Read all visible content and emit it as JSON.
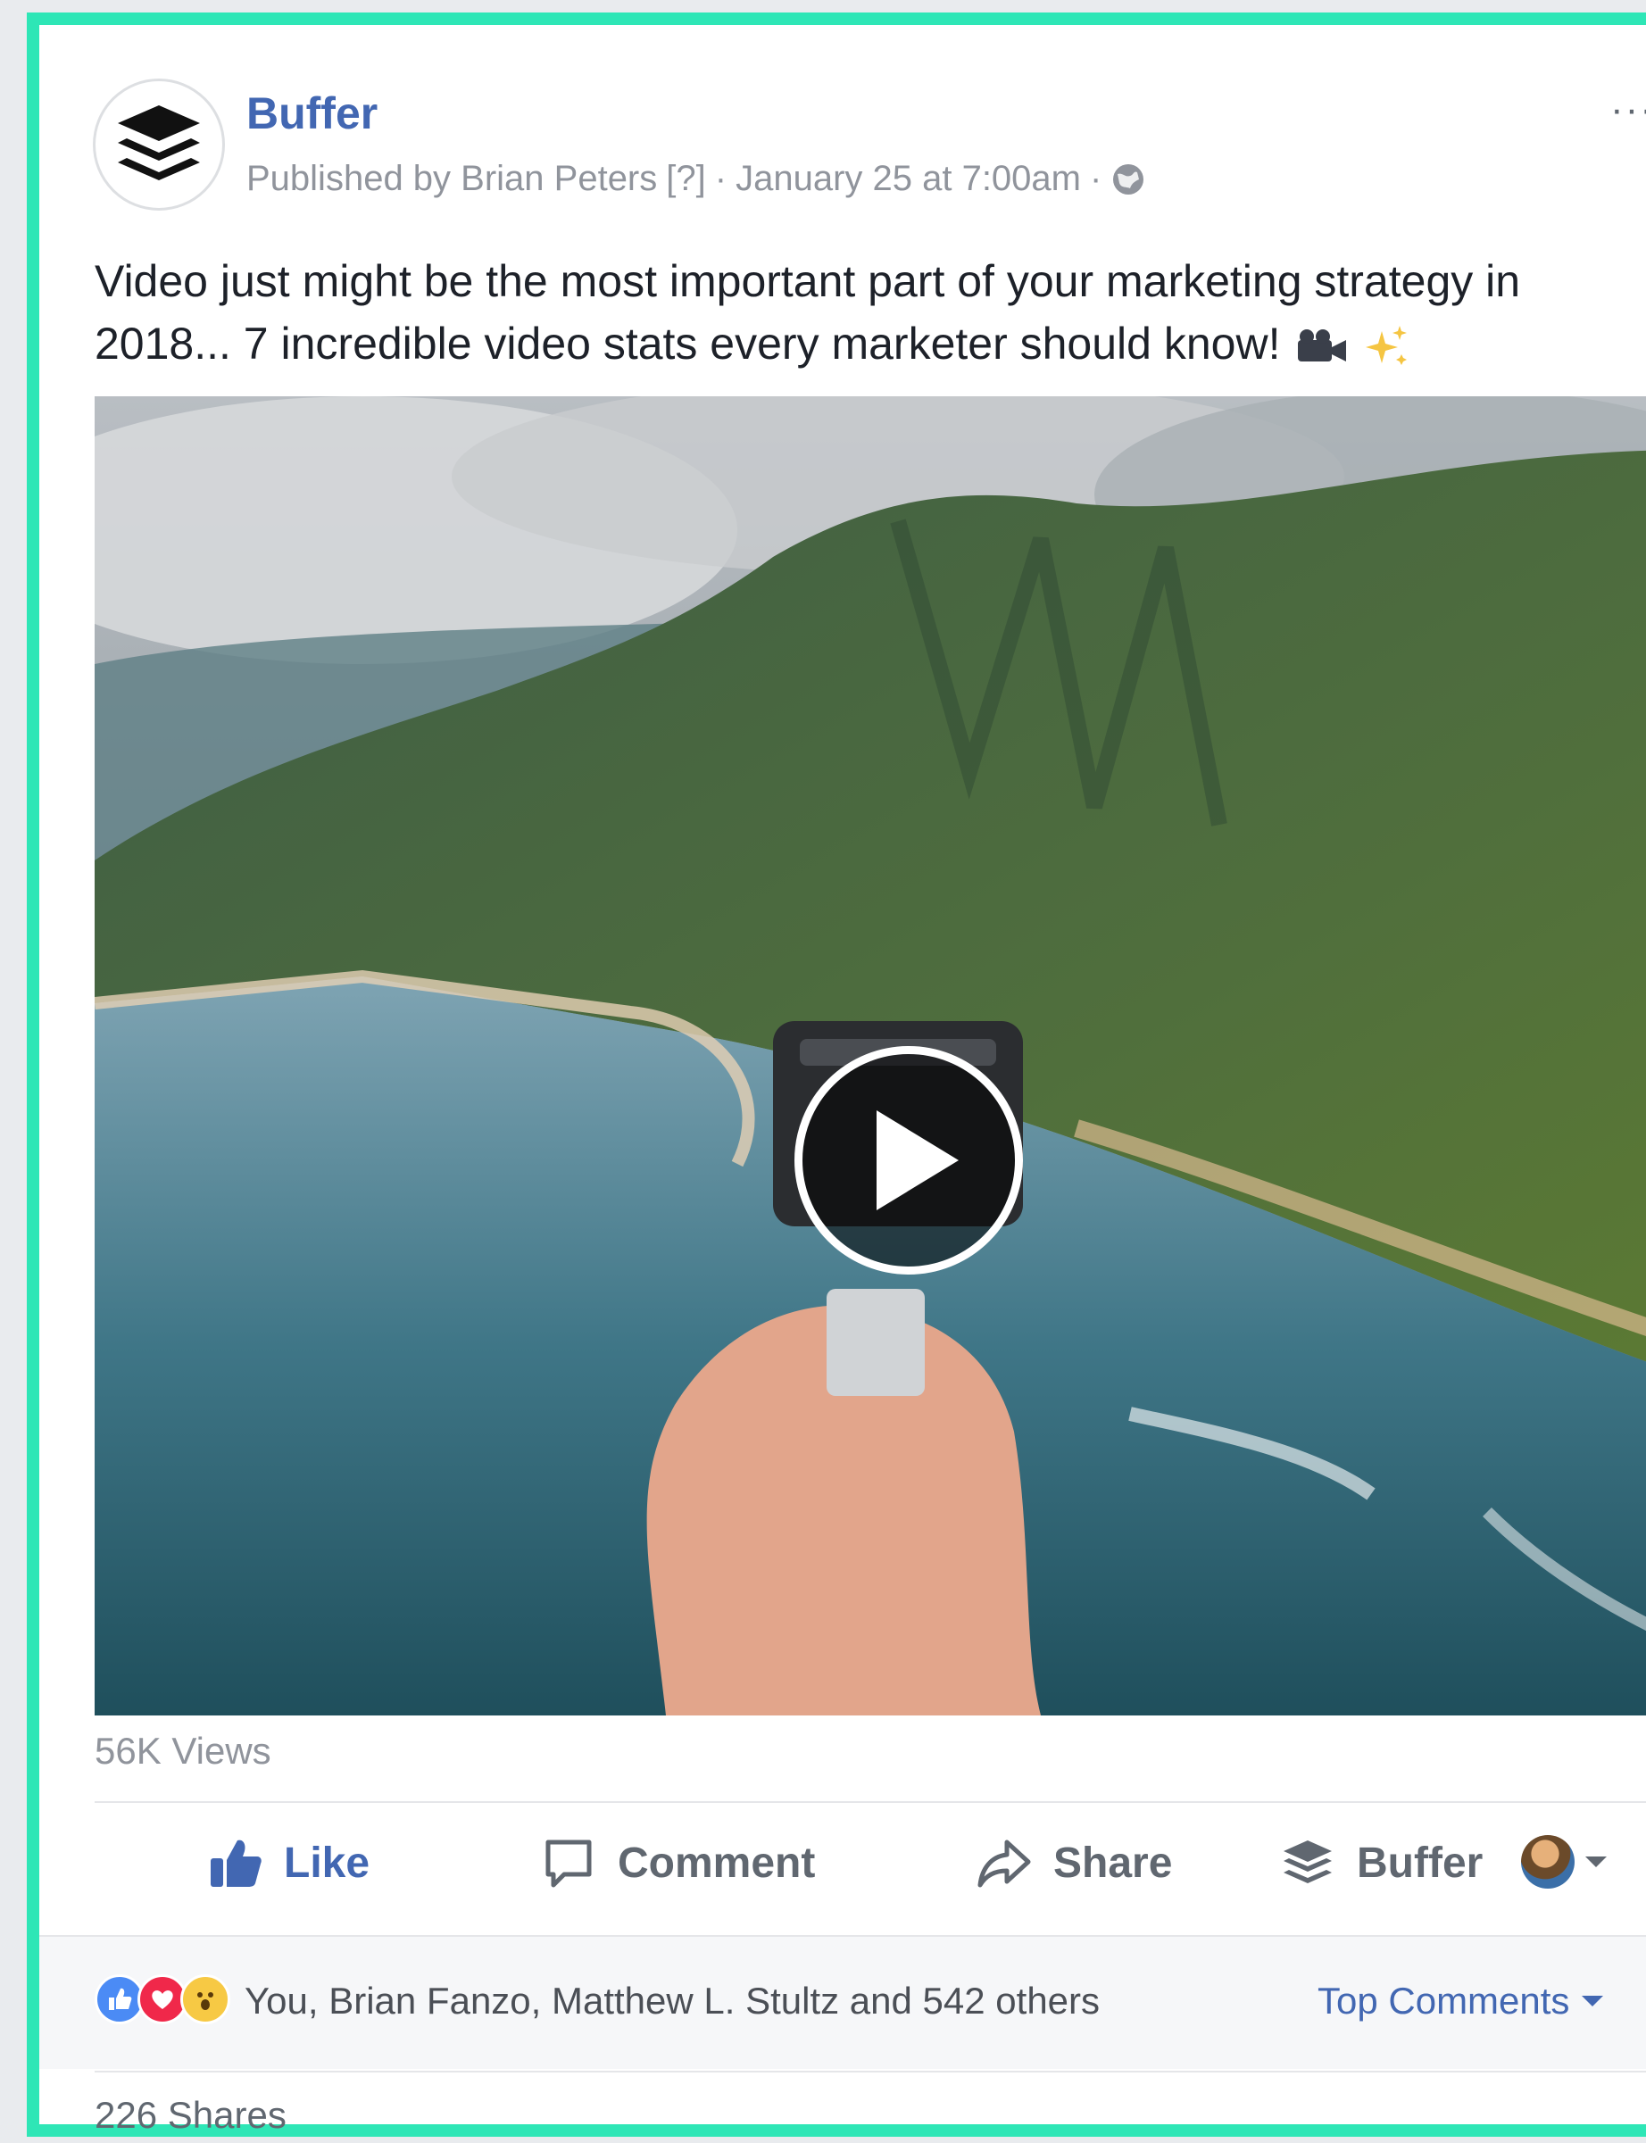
{
  "post": {
    "page_name": "Buffer",
    "meta": {
      "published_by": "Published by Brian Peters",
      "help_marker": "[?]",
      "separator": "·",
      "timestamp": "January 25 at 7:00am",
      "audience_icon": "globe-icon"
    },
    "more_label": "···",
    "text_line1": "Video just might be the most important part of your marketing strategy in",
    "text_line2": "2018... 7 incredible video stats every marketer should know!",
    "emojis": [
      "movie-camera-icon",
      "sparkles-icon"
    ]
  },
  "video": {
    "views": "56K Views",
    "play_icon": "play-icon"
  },
  "actions": {
    "like": "Like",
    "comment": "Comment",
    "share": "Share",
    "buffer": "Buffer"
  },
  "reactions": {
    "icons": [
      "like-reaction-icon",
      "love-reaction-icon",
      "wow-reaction-icon"
    ],
    "summary": "You, Brian Fanzo, Matthew L. Stultz and 542 others",
    "sort_label": "Top Comments"
  },
  "shares": "226 Shares",
  "colors": {
    "frame": "#2ee6b6",
    "link_blue": "#4267b2",
    "meta_gray": "#90949c",
    "text": "#1d2129"
  }
}
